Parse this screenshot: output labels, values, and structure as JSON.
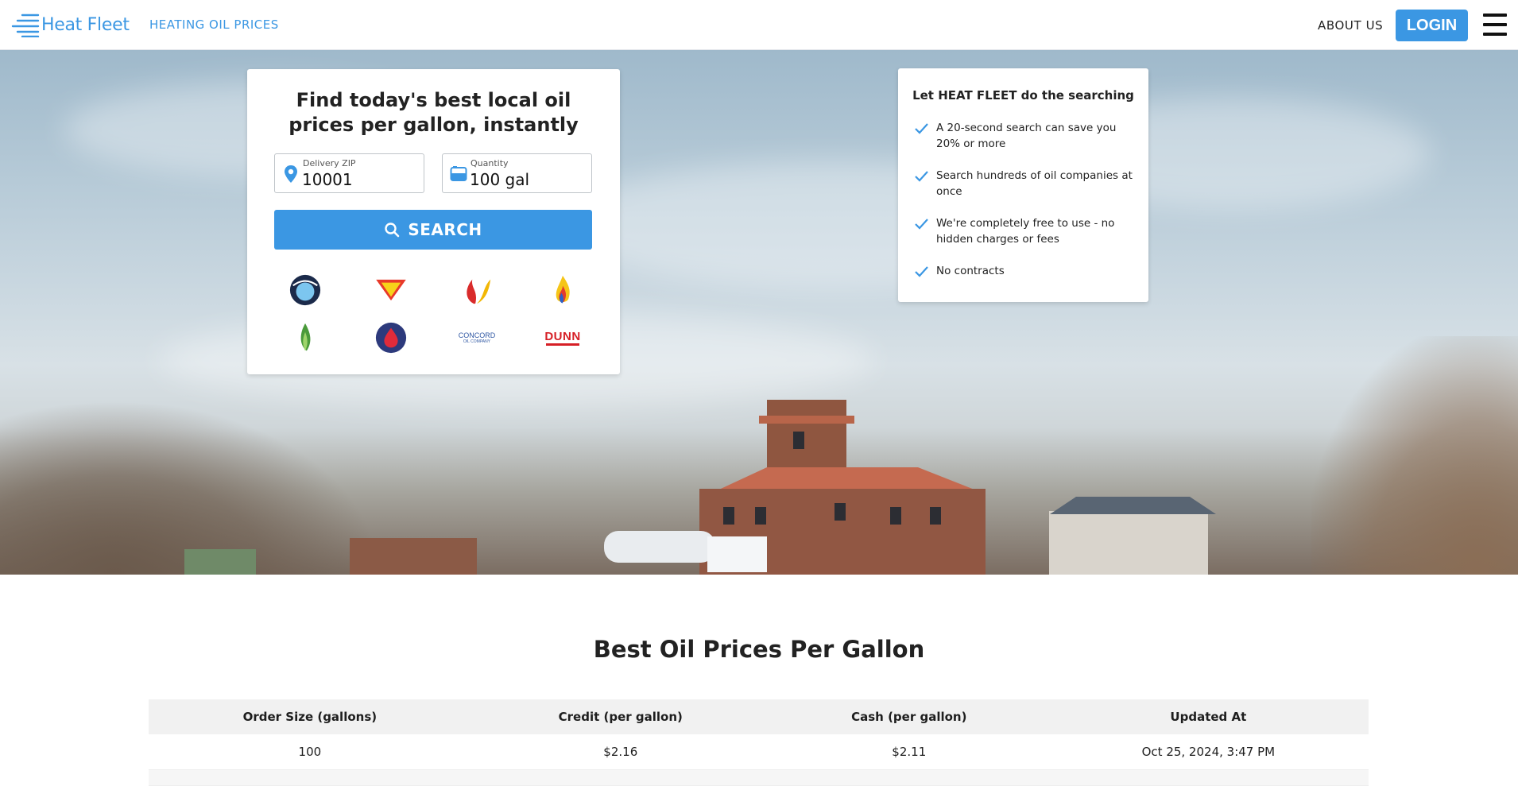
{
  "header": {
    "logo_text": "Heat Fleet",
    "nav_prices": "HEATING OIL PRICES",
    "nav_about": "ABOUT US",
    "login_label": "LOGIN"
  },
  "search_card": {
    "title": "Find today's best local oil prices per gallon, instantly",
    "zip_label": "Delivery ZIP",
    "zip_value": "10001",
    "qty_label": "Quantity",
    "qty_value": "100 gal",
    "search_label": "SEARCH",
    "brands": [
      {
        "icon": "peterson-logo-icon"
      },
      {
        "icon": "triangle-logo-icon"
      },
      {
        "icon": "red-flame-logo-icon"
      },
      {
        "icon": "multicolor-flame-logo-icon"
      },
      {
        "icon": "green-flame-logo-icon"
      },
      {
        "icon": "drop-logo-icon"
      },
      {
        "icon": "concord-logo-icon",
        "text_top": "CONCORD",
        "text_bottom": "OIL COMPANY"
      },
      {
        "icon": "dunn-logo-icon",
        "text": "DUNN"
      }
    ]
  },
  "benefits": {
    "title": "Let HEAT FLEET do the searching",
    "items": [
      "A 20-second search can save you 20% or more",
      "Search hundreds of oil companies at once",
      "We're completely free to use - no hidden charges or fees",
      "No contracts"
    ]
  },
  "prices": {
    "title": "Best Oil Prices Per Gallon",
    "columns": [
      "Order Size (gallons)",
      "Credit (per gallon)",
      "Cash (per gallon)",
      "Updated At"
    ],
    "rows": [
      [
        "100",
        "$2.16",
        "$2.11",
        "Oct 25, 2024, 3:47 PM"
      ]
    ]
  },
  "colors": {
    "accent": "#3b97e3"
  }
}
